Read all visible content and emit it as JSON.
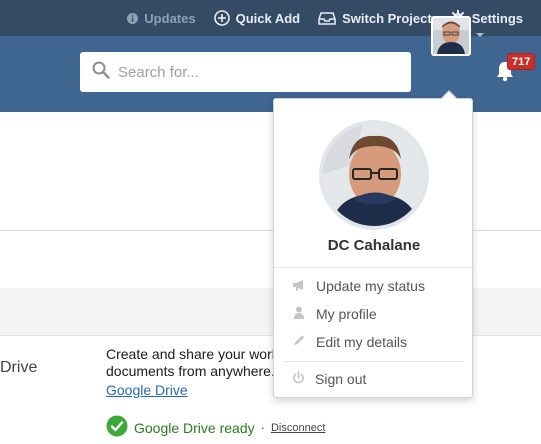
{
  "topbar": {
    "updates_label": "Updates",
    "quick_add_label": "Quick Add",
    "switch_project_label": "Switch Project",
    "settings_label": "Settings"
  },
  "search": {
    "placeholder": "Search for...",
    "value": ""
  },
  "notifications": {
    "count": "717"
  },
  "user_menu": {
    "name": "DC Cahalane",
    "items": [
      {
        "label": "Update my status",
        "icon": "megaphone-icon"
      },
      {
        "label": "My profile",
        "icon": "person-icon"
      },
      {
        "label": "Edit my details",
        "icon": "pencil-icon"
      }
    ],
    "sign_out_label": "Sign out"
  },
  "integration": {
    "name": "Drive",
    "description": "Create and share your work documents from anywhere.",
    "link_label": "Google Drive",
    "status_text": "Google Drive ready",
    "separator": "·",
    "disconnect_label": "Disconnect"
  },
  "colors": {
    "topbar": "#354a64",
    "header": "#3f6591",
    "badge": "#c9302c",
    "link": "#2a6ab1",
    "ready": "#2a7c1f"
  }
}
